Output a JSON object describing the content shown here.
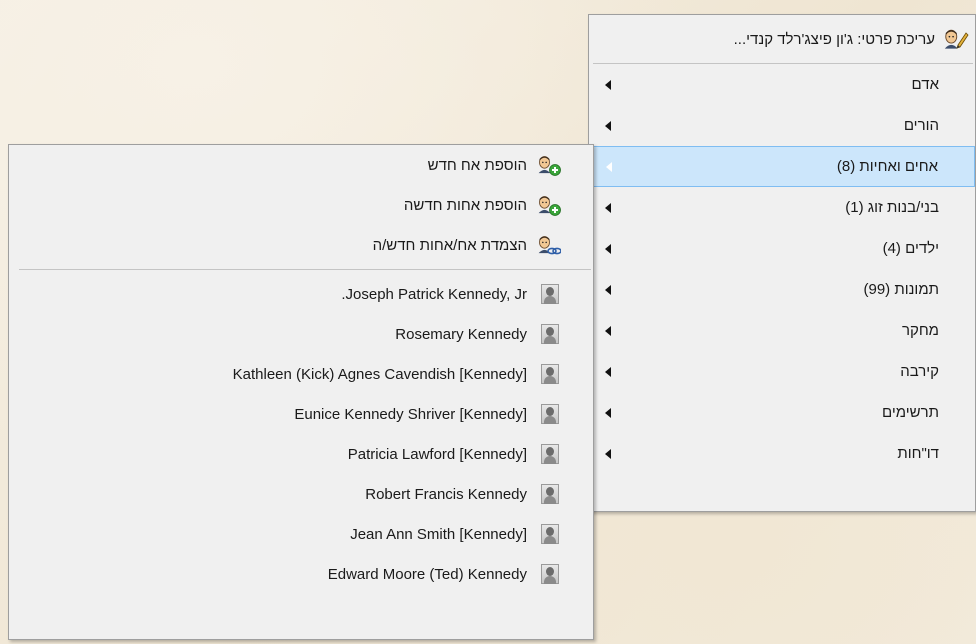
{
  "main_menu": {
    "header": {
      "label": "עריכת פרטי: ג'ון פיצג'רלד קנדי...",
      "icon": "edit-person-icon"
    },
    "items": [
      {
        "label": "אדם"
      },
      {
        "label": "הורים"
      },
      {
        "label": "אחים ואחיות (8)"
      },
      {
        "label": "בני/בנות זוג (1)"
      },
      {
        "label": "ילדים (4)"
      },
      {
        "label": "תמונות (99)"
      },
      {
        "label": "מחקר"
      },
      {
        "label": "קירבה"
      },
      {
        "label": "תרשימים"
      },
      {
        "label": "דו\"חות"
      }
    ],
    "highlighted_index": 2
  },
  "sub_menu": {
    "actions": [
      {
        "label": "הוספת אח חדש",
        "icon": "add-person-icon"
      },
      {
        "label": "הוספת אחות חדשה",
        "icon": "add-person-icon"
      },
      {
        "label": "הצמדת אח/אחות חדש/ה",
        "icon": "link-person-icon"
      }
    ],
    "siblings": [
      {
        "name": "Joseph Patrick Kennedy, Jr."
      },
      {
        "name": "Rosemary Kennedy"
      },
      {
        "name": "Kathleen (Kick) Agnes Cavendish [Kennedy]"
      },
      {
        "name": "Eunice Kennedy Shriver [Kennedy]"
      },
      {
        "name": "Patricia Lawford [Kennedy]"
      },
      {
        "name": "Robert Francis Kennedy"
      },
      {
        "name": "Jean Ann Smith [Kennedy]"
      },
      {
        "name": "Edward Moore (Ted) Kennedy"
      }
    ]
  },
  "colors": {
    "highlight_bg": "#cce6fb",
    "highlight_border": "#7fbdf2",
    "menu_bg": "#f0f0f0"
  }
}
